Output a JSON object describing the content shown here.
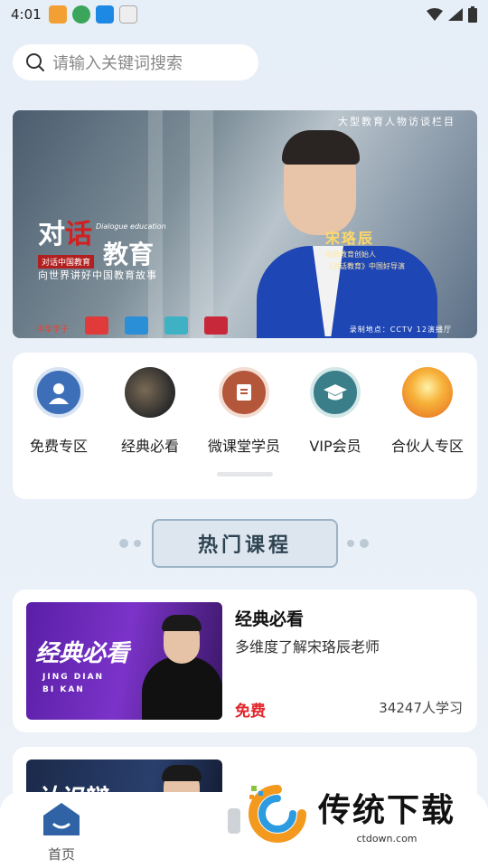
{
  "status_bar": {
    "time": "4:01"
  },
  "search": {
    "placeholder": "请输入关键词搜索"
  },
  "banner": {
    "top_caption": "大型教育人物访谈栏目",
    "title_part1": "对",
    "title_part2": "话",
    "title_part3": "教育",
    "subtitle_en": "Dialogue education",
    "org": "对话中国教育",
    "tagline": "向世界讲好中国教育故事",
    "guest_name": "宋珞辰",
    "guest_line1": "珞辰教育创始人",
    "guest_line2": "《对话教育》中国好导演",
    "bottom_caption": "录制地点：CCTV 12演播厅",
    "logo_text": "中华学子"
  },
  "categories": [
    {
      "label": "免费专区",
      "icon": "user-icon",
      "color": "#3c6fb8"
    },
    {
      "label": "经典必看",
      "icon": "photo-icon",
      "color": "#2b2b2b"
    },
    {
      "label": "微课堂学员",
      "icon": "card-icon",
      "color": "#b3563a"
    },
    {
      "label": "VIP会员",
      "icon": "graduation-cap-icon",
      "color": "#3a7e89"
    },
    {
      "label": "合伙人专区",
      "icon": "sunset-icon",
      "color": "#f29a2a"
    }
  ],
  "section": {
    "title": "热门课程"
  },
  "courses": [
    {
      "thumb_title": "经典必看",
      "thumb_en_1": "JING DIAN",
      "thumb_en_2": "BI KAN",
      "name": "经典必看",
      "desc": "多维度了解宋珞辰老师",
      "price": "免费",
      "count": "34247人学习"
    },
    {
      "thumb_title": "认识辩…",
      "name": "",
      "desc": "",
      "price": "",
      "count": ""
    }
  ],
  "nav": {
    "home_label": "首页"
  },
  "watermark": {
    "title": "传统下载",
    "url": "ctdown.com"
  },
  "colors": {
    "accent_red": "#e0262b",
    "nav_blue": "#2f63a6"
  }
}
